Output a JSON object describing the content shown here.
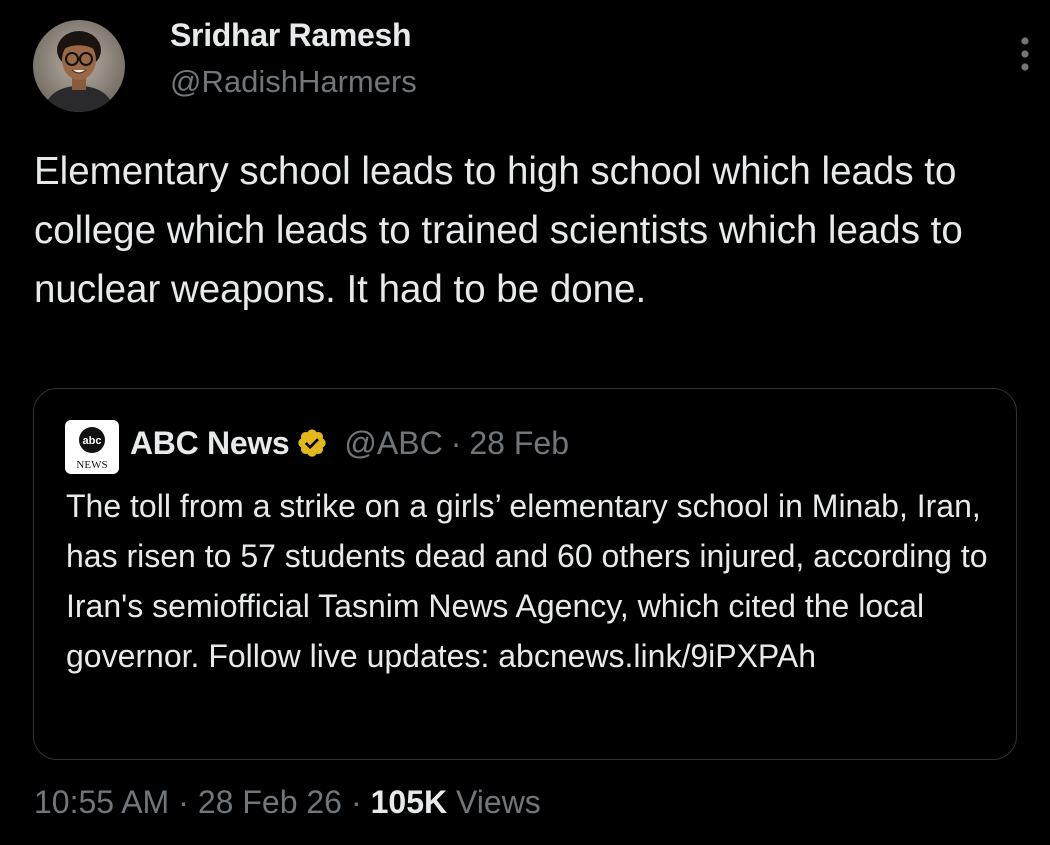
{
  "author": {
    "name": "Sridhar Ramesh",
    "handle": "@RadishHarmers"
  },
  "tweet": {
    "text": "Elementary school leads to high school which leads to college which leads to trained scientists which leads to nuclear weapons. It had to be done."
  },
  "quoted": {
    "logo_text": "abc",
    "logo_sub": "NEWS",
    "name": "ABC News",
    "handle": "@ABC",
    "separator": "·",
    "date": "28 Feb",
    "text": "The toll from a strike on a girls’ elementary school in Minab, Iran, has risen to 57 students dead and 60 others injured, according to Iran's semiofficial Tasnim News Agency, which cited the local governor. Follow live updates: abcnews.link/9iPXPAh"
  },
  "meta": {
    "time": "10:55 AM",
    "date": "28 Feb 26",
    "separator": "·",
    "views_count": "105K",
    "views_label": "Views"
  },
  "colors": {
    "background": "#000000",
    "text_primary": "#e7e9ea",
    "text_secondary": "#71767b",
    "border": "#2f3336",
    "verified_gold": "#e2b719"
  },
  "icons": {
    "more": "more-vertical-icon",
    "verified": "verified-gold-badge-icon"
  }
}
